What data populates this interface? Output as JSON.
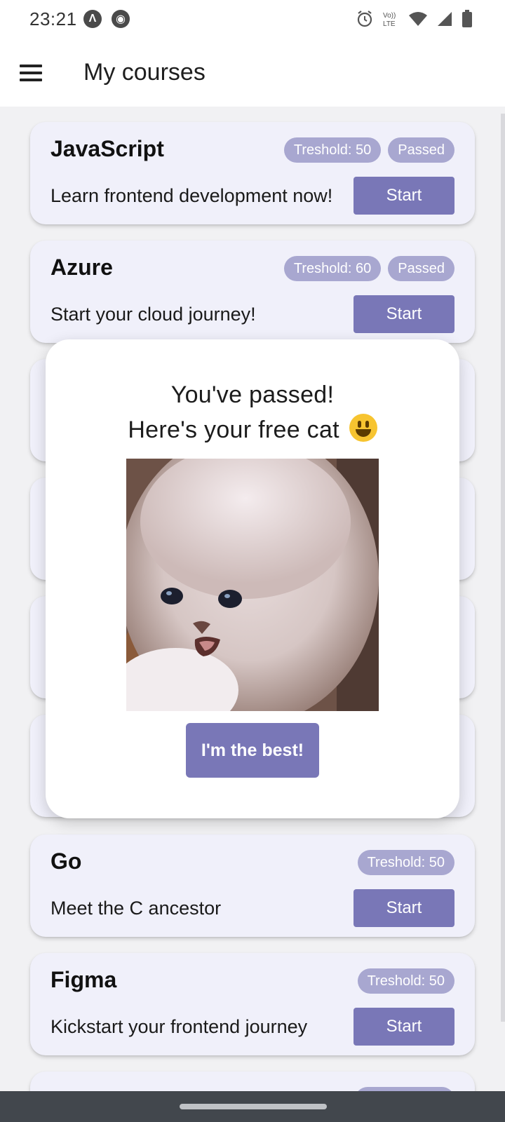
{
  "status_bar": {
    "time": "23:21",
    "left_icons": [
      "notification-a-icon",
      "notification-b-icon"
    ],
    "right_icons": [
      "alarm-icon",
      "volte-icon",
      "wifi-icon",
      "signal-icon",
      "battery-icon"
    ],
    "volte_label_top": "Vo))",
    "volte_label_bottom": "LTE"
  },
  "app_bar": {
    "menu_icon": "hamburger-menu-icon",
    "title": "My courses"
  },
  "courses": [
    {
      "title": "JavaScript",
      "description": "Learn frontend development now!",
      "threshold": "Treshold: 50",
      "status": "Passed",
      "button": "Start"
    },
    {
      "title": "Azure",
      "description": "Start your cloud journey!",
      "threshold": "Treshold: 60",
      "status": "Passed",
      "button": "Start"
    },
    {
      "title": "Go",
      "description": "Meet the C ancestor",
      "threshold": "Treshold: 50",
      "button": "Start"
    },
    {
      "title": "Figma",
      "description": "Kickstart your frontend journey",
      "threshold": "Treshold: 50",
      "button": "Start"
    }
  ],
  "dialog": {
    "line1": "You've passed!",
    "line2": "Here's your free cat",
    "emoji": "smiling-face-emoji",
    "image": "white-kitten-photo",
    "button": "I'm the best!"
  },
  "colors": {
    "accent": "#7977b7",
    "chip": "#a8a7d0",
    "card_bg": "#f0f0fa",
    "page_bg": "#f1f1f3",
    "nav_bar": "#42474d"
  }
}
